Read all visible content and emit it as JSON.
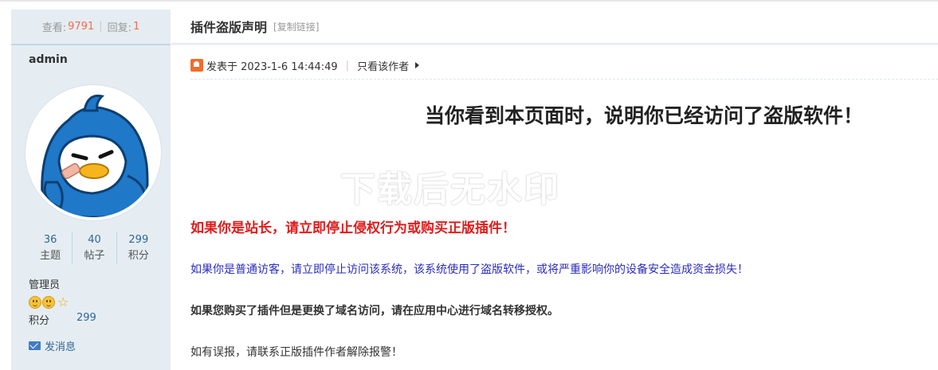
{
  "sidebar": {
    "views_label": "查看:",
    "views_value": "9791",
    "replies_label": "回复:",
    "replies_value": "1",
    "username": "admin",
    "stats": [
      {
        "value": "36",
        "label": "主题"
      },
      {
        "value": "40",
        "label": "帖子"
      },
      {
        "value": "299",
        "label": "积分"
      }
    ],
    "group": "管理员",
    "credits_label": "积分",
    "credits_value": "299",
    "message_label": "发消息"
  },
  "thread": {
    "title": "插件盗版声明",
    "copy_link": "[复制链接]"
  },
  "post": {
    "posted_at": "发表于 2023-1-6 14:44:49",
    "only_author": "只看该作者",
    "headline": "当你看到本页面时，说明你已经访问了盗版软件！",
    "watermark": "下载后无水印",
    "warn_red": "如果你是站长，请立即停止侵权行为或购买正版插件！",
    "warn_blue": "如果你是普通访客，请立即停止访问该系统，该系统使用了盗版软件，或将严重影响你的设备安全造成资金损失！",
    "warn_bold": "如果您购买了插件但是更换了域名访问，请在应用中心进行域名转移授权。",
    "warn_plain": "如有误报，请联系正版插件作者解除报警！"
  },
  "colors": {
    "sidebar_bg": "#e5edf2",
    "red": "#e01c1c",
    "blue": "#2a2cbf",
    "link": "#336699"
  },
  "icons": [
    "penguin-avatar",
    "smile-icon",
    "star-icon",
    "mail-icon",
    "post-icon",
    "arrow-right-icon"
  ]
}
